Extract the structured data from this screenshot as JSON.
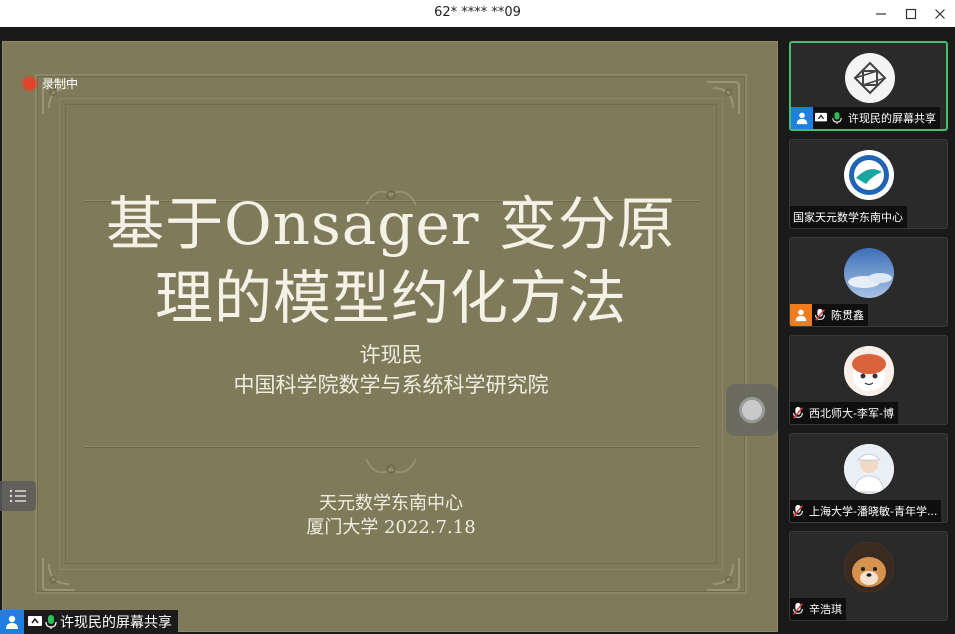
{
  "window": {
    "title": "62* **** **09"
  },
  "recording": {
    "label": "录制中"
  },
  "slide": {
    "title_line1": "基于Onsager 变分原",
    "title_line2": "理的模型约化方法",
    "author_name": "许现民",
    "author_affiliation": "中国科学院数学与系统科学研究院",
    "bottom_line1": "天元数学东南中心",
    "bottom_line2": "厦门大学 2022.7.18"
  },
  "share_bar": {
    "label": "许现民的屏幕共享",
    "accent": "#1e7fe0"
  },
  "participants": [
    {
      "name": "许现民的屏幕共享",
      "role_color": "#1e7fe0",
      "active": true
    },
    {
      "name": "国家天元数学东南中心"
    },
    {
      "name": "陈贯鑫",
      "role_color": "#f07c1e"
    },
    {
      "name": "西北师大-李军-博"
    },
    {
      "name": "上海大学-潘晓敏-青年学..."
    },
    {
      "name": "辛浩琪"
    }
  ],
  "colors": {
    "slide_bg": "#7f7b5a",
    "active_border": "#3fbf6f",
    "mic_on": "#2ec15a"
  }
}
